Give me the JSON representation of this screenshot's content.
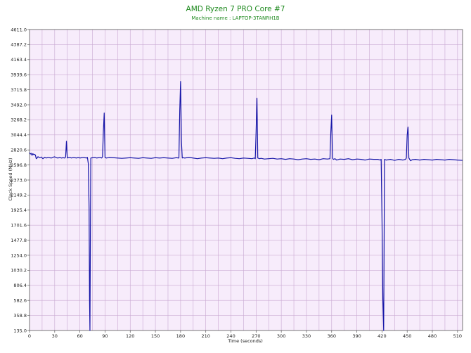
{
  "chart_data": {
    "type": "line",
    "title": "AMD Ryzen 7 PRO Core #7",
    "subtitle": "Machine name : LAPTOP-3TANRH1B",
    "xlabel": "Time (seconds)",
    "ylabel": "Clock Speed (MHz)",
    "xlim": [
      0,
      516
    ],
    "ylim": [
      135.0,
      4611.0
    ],
    "x_ticks": [
      0,
      30,
      60,
      90,
      120,
      150,
      180,
      210,
      240,
      270,
      300,
      330,
      360,
      390,
      420,
      450,
      480,
      510
    ],
    "y_ticks": [
      135.0,
      358.8,
      582.6,
      806.4,
      1030.2,
      1254.0,
      1477.8,
      1701.6,
      1925.4,
      2149.2,
      2373.0,
      2596.8,
      2820.6,
      3044.4,
      3268.2,
      3492.0,
      3715.8,
      3939.6,
      4163.4,
      4387.2,
      4611.0
    ],
    "grid": true,
    "background": "#f7ecfb",
    "grid_color": "#c9a8d2",
    "line_color": "#1616a8",
    "title_color": "#1f8a1f",
    "series": [
      {
        "x": [
          0,
          1,
          2,
          3,
          4,
          5,
          6,
          7,
          8,
          9,
          10,
          12,
          14,
          16,
          18,
          20,
          22,
          24,
          26,
          28,
          30,
          32,
          34,
          36,
          38,
          40,
          42,
          43,
          44,
          45,
          46,
          48,
          50,
          52,
          54,
          56,
          58,
          60,
          62,
          64,
          66,
          68,
          69,
          70,
          71,
          71.5,
          72,
          73,
          75,
          78,
          80,
          82,
          84,
          86,
          87,
          88,
          89,
          90,
          92,
          95,
          100,
          105,
          110,
          115,
          120,
          125,
          130,
          135,
          140,
          145,
          150,
          155,
          160,
          165,
          170,
          175,
          178,
          179,
          180,
          181,
          182,
          183,
          185,
          190,
          195,
          200,
          205,
          210,
          215,
          220,
          225,
          230,
          235,
          240,
          245,
          250,
          255,
          260,
          265,
          268,
          269,
          270,
          271,
          272,
          274,
          276,
          280,
          285,
          290,
          295,
          300,
          305,
          310,
          315,
          320,
          325,
          330,
          335,
          340,
          345,
          350,
          355,
          358,
          359,
          360,
          361,
          362,
          364,
          366,
          370,
          375,
          380,
          385,
          390,
          395,
          400,
          405,
          410,
          415,
          418,
          419,
          420,
          421,
          422,
          423,
          425,
          430,
          435,
          440,
          445,
          448,
          449,
          450,
          451,
          452,
          454,
          456,
          460,
          465,
          470,
          475,
          480,
          485,
          490,
          495,
          500,
          505,
          510,
          516
        ],
        "y": [
          2780,
          2760,
          2770,
          2740,
          2765,
          2750,
          2755,
          2745,
          2690,
          2700,
          2720,
          2705,
          2715,
          2690,
          2712,
          2700,
          2710,
          2705,
          2700,
          2712,
          2718,
          2705,
          2700,
          2710,
          2700,
          2705,
          2700,
          2715,
          2950,
          2700,
          2705,
          2710,
          2700,
          2708,
          2705,
          2700,
          2710,
          2700,
          2705,
          2710,
          2705,
          2700,
          2710,
          2620,
          1950,
          600,
          135,
          2700,
          2705,
          2710,
          2700,
          2705,
          2710,
          2700,
          2720,
          3100,
          3370,
          2705,
          2700,
          2710,
          2705,
          2700,
          2695,
          2700,
          2705,
          2700,
          2695,
          2705,
          2700,
          2695,
          2705,
          2700,
          2705,
          2700,
          2695,
          2705,
          2700,
          3400,
          3840,
          2950,
          2700,
          2705,
          2700,
          2710,
          2700,
          2690,
          2700,
          2705,
          2700,
          2695,
          2700,
          2690,
          2700,
          2705,
          2695,
          2690,
          2700,
          2695,
          2690,
          2700,
          2690,
          3100,
          3590,
          2700,
          2690,
          2695,
          2685,
          2690,
          2695,
          2685,
          2690,
          2680,
          2690,
          2685,
          2675,
          2685,
          2690,
          2680,
          2685,
          2675,
          2690,
          2685,
          2690,
          3080,
          3340,
          2700,
          2680,
          2690,
          2670,
          2685,
          2680,
          2690,
          2675,
          2685,
          2680,
          2670,
          2685,
          2680,
          2680,
          2670,
          2680,
          1800,
          600,
          135,
          2680,
          2670,
          2680,
          2665,
          2680,
          2670,
          2680,
          2700,
          3040,
          3160,
          2700,
          2660,
          2675,
          2680,
          2670,
          2680,
          2675,
          2670,
          2680,
          2675,
          2670,
          2680,
          2675,
          2670,
          2665
        ]
      }
    ]
  }
}
